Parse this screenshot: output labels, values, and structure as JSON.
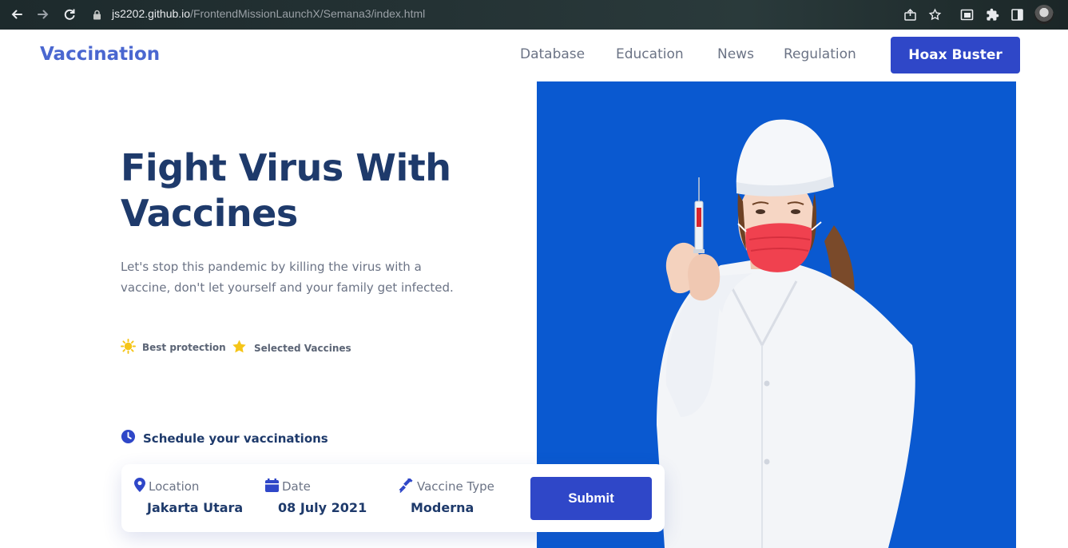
{
  "browser": {
    "url_host": "js2202.github.io",
    "url_path": "/FrontendMissionLaunchX/Semana3/index.html",
    "icons": [
      "back-icon",
      "forward-icon",
      "reload-icon",
      "lock-icon",
      "share-icon",
      "star-icon",
      "media-icon",
      "extensions-icon",
      "sidepanel-icon",
      "profile-avatar"
    ]
  },
  "header": {
    "logo": "Vaccination",
    "nav": [
      "Database",
      "Education",
      "News",
      "Regulation"
    ],
    "cta": "Hoax Buster"
  },
  "hero": {
    "title": "Fight Virus With Vaccines",
    "description": "Let's stop this pandemic by killing the virus with a vaccine, don't let yourself and your family get infected.",
    "badges": [
      {
        "icon": "sun-icon",
        "label": "Best protection"
      },
      {
        "icon": "star-icon",
        "label": "Selected Vaccines"
      }
    ],
    "schedule_label": "Schedule your vaccinations"
  },
  "booking": {
    "fields": [
      {
        "icon": "map-pin-icon",
        "label": "Location",
        "value": "Jakarta Utara"
      },
      {
        "icon": "calendar-icon",
        "label": "Date",
        "value": "08 July 2021"
      },
      {
        "icon": "syringe-icon",
        "label": "Vaccine Type",
        "value": "Moderna"
      }
    ],
    "submit": "Submit"
  },
  "colors": {
    "brand": "#2f47c8",
    "logo": "#4a67d0",
    "heading": "#1e3a6b",
    "muted": "#6b7385",
    "hero_bg": "#0a59d0",
    "accent_yellow": "#f5c518"
  }
}
